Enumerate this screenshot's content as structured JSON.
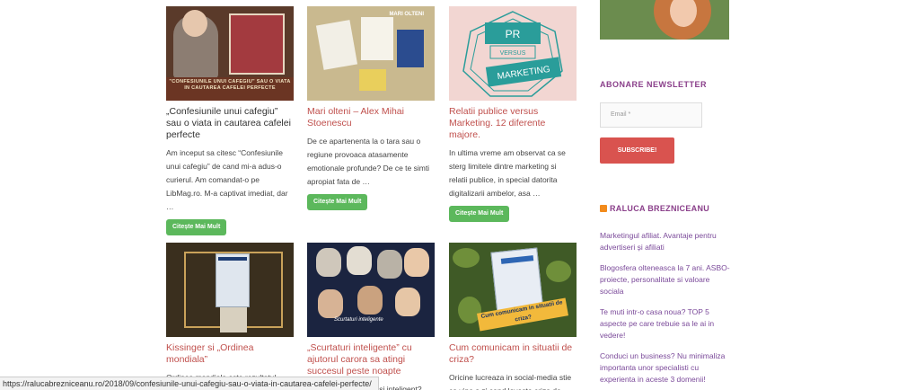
{
  "cards": [
    {
      "title": "„Confesiunile unui cafegiu” sau o viata in cautarea cafelei perfecte",
      "excerpt": "Am inceput sa citesc “Confesiunile unui cafegiu” de cand mi-a adus-o curierul. Am comandat-o pe LibMag.ro. M-a captivat imediat, dar …",
      "button": "Citește Mai Mult",
      "thumb_caption": "\"CONFESIUNILE UNUI CAFEGIU\" SAU O VIATA IN CAUTAREA CAFELEI PERFECTE"
    },
    {
      "title": "Mari olteni – Alex Mihai Stoenescu",
      "excerpt": "De ce apartenenta la o tara sau o regiune provoaca atasamente emotionale profunde? De ce te simti apropiat fata de …",
      "button": "Citește Mai Mult",
      "thumb_caption": "MARI OLTENI"
    },
    {
      "title": "Relatii publice versus Marketing. 12 diferente majore.",
      "excerpt": "In ultima vreme am observat ca se sterg limitele dintre marketing si relatii publice, in special datorita digitalizarii ambelor, asa …",
      "button": "Citește Mai Mult",
      "thumb_words": [
        "PR",
        "VERSUS",
        "MARKETING"
      ]
    },
    {
      "title": "Kissinger si „Ordinea mondiala”",
      "excerpt": "Ordinea mondiala este rezultatul direct al deciziilor oamenilor aflati in"
    },
    {
      "title": "„Scurtaturi inteligente” cu ajutorul carora sa atingi succesul peste noapte",
      "excerpt": "Nu vrei sa fii sclipitor si inteligent?",
      "thumb_caption": "Scurtaturi inteligente"
    },
    {
      "title": "Cum comunicam in situatii de criza?",
      "excerpt": "Oricine lucreaza in social-media stie ca vine o zi cand loveste criza de",
      "thumb_caption": "Cum comunicam in situatii de criza?"
    }
  ],
  "sidebar": {
    "newsletter_title": "ABONARE NEWSLETTER",
    "email_placeholder": "Email *",
    "subscribe_label": "SUBSCRIBE!",
    "rss_title": "RALUCA BREZNICEANU",
    "rss_items": [
      "Marketingul afiliat. Avantaje pentru advertiseri și afiliati",
      "Blogosfera olteneasca la 7 ani. ASBO-proiecte, personalitate si valoare sociala",
      "Te muti intr-o casa noua? TOP 5 aspecte pe care trebuie sa le ai in vedere!",
      "Conduci un business? Nu minimaliza importanta unor specialisti cu experienta in aceste 3 domenii!"
    ]
  },
  "statusbar": {
    "url": "https://ralucabrezniceanu.ro/2018/09/confesiunile-unui-cafegiu-sau-o-viata-in-cautarea-cafelei-perfecte/"
  },
  "colors": {
    "title_red": "#c0504d",
    "button_green": "#5cb85c",
    "subscribe_red": "#d9534f",
    "sidebar_purple": "#8a3f8a"
  }
}
